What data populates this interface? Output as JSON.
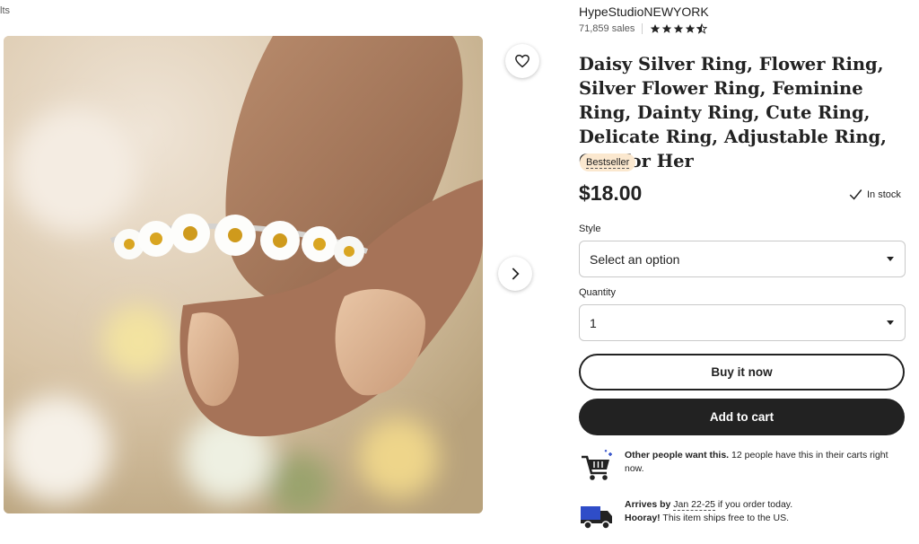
{
  "breadcrumb_fragment": "lts",
  "shop": {
    "name": "HypeStudioNEWYORK",
    "sales": "71,859 sales",
    "rating": 4.5
  },
  "product": {
    "title": "Daisy Silver Ring, Flower Ring, Silver Flower Ring, Feminine Ring, Dainty Ring, Cute Ring, Delicate Ring, Adjustable Ring, Gift for Her",
    "badge": "Bestseller",
    "price": "$18.00",
    "stock": "In stock"
  },
  "options": {
    "style_label": "Style",
    "style_value": "Select an option",
    "quantity_label": "Quantity",
    "quantity_value": "1"
  },
  "actions": {
    "buy_now": "Buy it now",
    "add_to_cart": "Add to cart"
  },
  "highlights": {
    "demand_bold": "Other people want this.",
    "demand_text": " 12 people have this in their carts right now.",
    "arrives_bold": "Arrives by",
    "arrives_dates": "Jan 22-25",
    "arrives_text": " if you order today.",
    "shipping_bold": "Hooray!",
    "shipping_text": " This item ships free to the US."
  },
  "icons": {
    "favorite": "heart-icon",
    "next": "chevron-right-icon",
    "stock": "checkmark-icon",
    "cart": "cart-icon",
    "truck": "truck-icon",
    "dropdown": "caret-down-icon"
  },
  "colors": {
    "badge_bg": "#fbe8cf",
    "primary_button": "#222222",
    "truck_blue": "#2f4dc8"
  }
}
